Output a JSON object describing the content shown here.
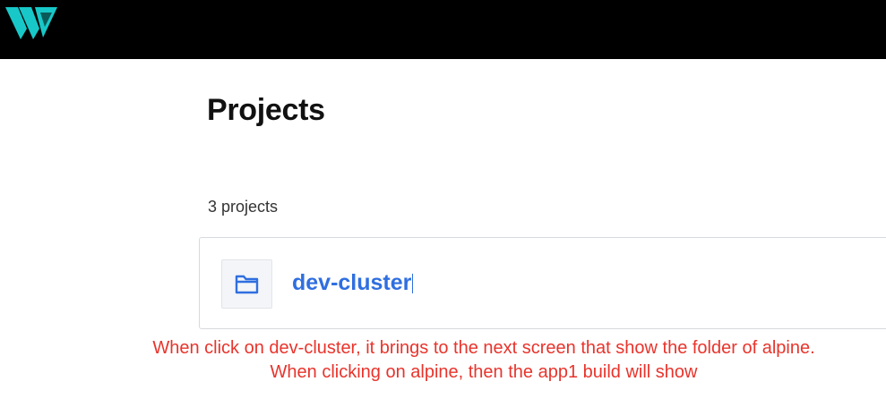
{
  "header": {
    "logo_icon": "brand-logo-icon",
    "background_color": "#000000",
    "logo_color": "#18c8c8"
  },
  "page": {
    "title": "Projects",
    "count_text": "3 projects"
  },
  "projects": [
    {
      "name": "dev-cluster",
      "icon": "folder-icon",
      "link_color": "#2f6fe0"
    }
  ],
  "annotation": {
    "color": "#e8342c",
    "line1": "When click on dev-cluster, it brings to the next screen that show the folder of alpine.",
    "line2": "When clicking on alpine, then the app1 build will show"
  }
}
